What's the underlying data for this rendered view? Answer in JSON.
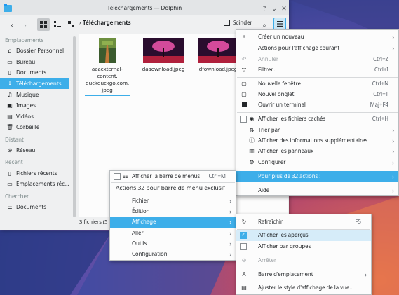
{
  "window": {
    "title": "Téléchargements — Dolphin"
  },
  "toolbar": {
    "breadcrumb": "Téléchargements",
    "split_label": "Scinder"
  },
  "sidebar": {
    "sections": [
      {
        "heading": "Emplacements",
        "items": [
          {
            "label": "Dossier Personnel",
            "icon": "home-icon"
          },
          {
            "label": "Bureau",
            "icon": "desktop-icon"
          },
          {
            "label": "Documents",
            "icon": "documents-icon"
          },
          {
            "label": "Téléchargements",
            "icon": "downloads-icon",
            "active": true
          },
          {
            "label": "Musique",
            "icon": "music-icon"
          },
          {
            "label": "Images",
            "icon": "images-icon"
          },
          {
            "label": "Vidéos",
            "icon": "videos-icon"
          },
          {
            "label": "Corbeille",
            "icon": "trash-icon"
          }
        ]
      },
      {
        "heading": "Distant",
        "items": [
          {
            "label": "Réseau",
            "icon": "network-icon"
          }
        ]
      },
      {
        "heading": "Récent",
        "items": [
          {
            "label": "Fichiers récents",
            "icon": "recent-files-icon"
          },
          {
            "label": "Emplacements réc...",
            "icon": "recent-places-icon"
          }
        ]
      },
      {
        "heading": "Chercher",
        "items": [
          {
            "label": "Documents",
            "icon": "search-documents-icon"
          }
        ]
      }
    ]
  },
  "files": [
    {
      "name": "aaaexternal-content.duckduckgo.com.jpeg",
      "lines": [
        "aaaexternal-",
        "content.",
        "duckduckgo.com.",
        "jpeg"
      ]
    },
    {
      "name": "daaownload.jpeg",
      "lines": [
        "daaownload.jpeg"
      ]
    },
    {
      "name": "dfownload.jpeg",
      "lines": [
        "dfownload.jpeg"
      ]
    }
  ],
  "status": {
    "text": "3 fichiers (5"
  },
  "hamburger_menu": {
    "items": [
      {
        "label": "Créer un nouveau",
        "icon": "plus-icon",
        "submenu": true
      },
      {
        "label": "Actions pour l'affichage courant",
        "submenu": true
      },
      {
        "label": "Annuler",
        "icon": "undo-icon",
        "shortcut": "Ctrl+Z",
        "disabled": true
      },
      {
        "label": "Filtrer...",
        "icon": "filter-icon",
        "shortcut": "Ctrl+I"
      },
      {
        "label": "Nouvelle fenêtre",
        "icon": "new-window-icon",
        "shortcut": "Ctrl+N"
      },
      {
        "label": "Nouvel onglet",
        "icon": "new-tab-icon",
        "shortcut": "Ctrl+T"
      },
      {
        "label": "Ouvrir un terminal",
        "icon": "terminal-icon",
        "shortcut": "Maj+F4"
      },
      {
        "label": "Afficher les fichiers cachés",
        "icon": "eye-icon",
        "shortcut": "Ctrl+H",
        "checkbox": true
      },
      {
        "label": "Trier par",
        "icon": "sort-icon",
        "submenu": true
      },
      {
        "label": "Afficher des informations supplémentaires",
        "icon": "info-icon",
        "submenu": true
      },
      {
        "label": "Afficher les panneaux",
        "icon": "panels-icon",
        "submenu": true
      },
      {
        "label": "Configurer",
        "icon": "configure-icon",
        "submenu": true
      },
      {
        "label": "Pour plus de 32 actions :",
        "submenu": true,
        "highlighted": true
      },
      {
        "label": "Aide",
        "submenu": true
      }
    ]
  },
  "menubar_menu": {
    "show_menubar_label": "Afficher la barre de menus",
    "show_menubar_shortcut": "Ctrl+M",
    "header": "Actions 32 pour barre de menu exclusif",
    "items": [
      {
        "label": "Fichier"
      },
      {
        "label": "Édition"
      },
      {
        "label": "Affichage",
        "highlighted": true
      },
      {
        "label": "Aller"
      },
      {
        "label": "Outils"
      },
      {
        "label": "Configuration"
      }
    ]
  },
  "view_menu": {
    "items": [
      {
        "label": "Rafraîchir",
        "icon": "refresh-icon",
        "shortcut": "F5"
      },
      {
        "label": "Afficher les aperçus",
        "checked": true
      },
      {
        "label": "Afficher par groupes",
        "checked": false
      },
      {
        "label": "Arrêter",
        "icon": "stop-icon",
        "disabled": true
      },
      {
        "label": "Barre d'emplacement",
        "icon": "location-bar-icon",
        "submenu": true
      },
      {
        "label": "Ajuster le style d'affichage de la vue...",
        "icon": "adjust-view-icon"
      }
    ]
  }
}
